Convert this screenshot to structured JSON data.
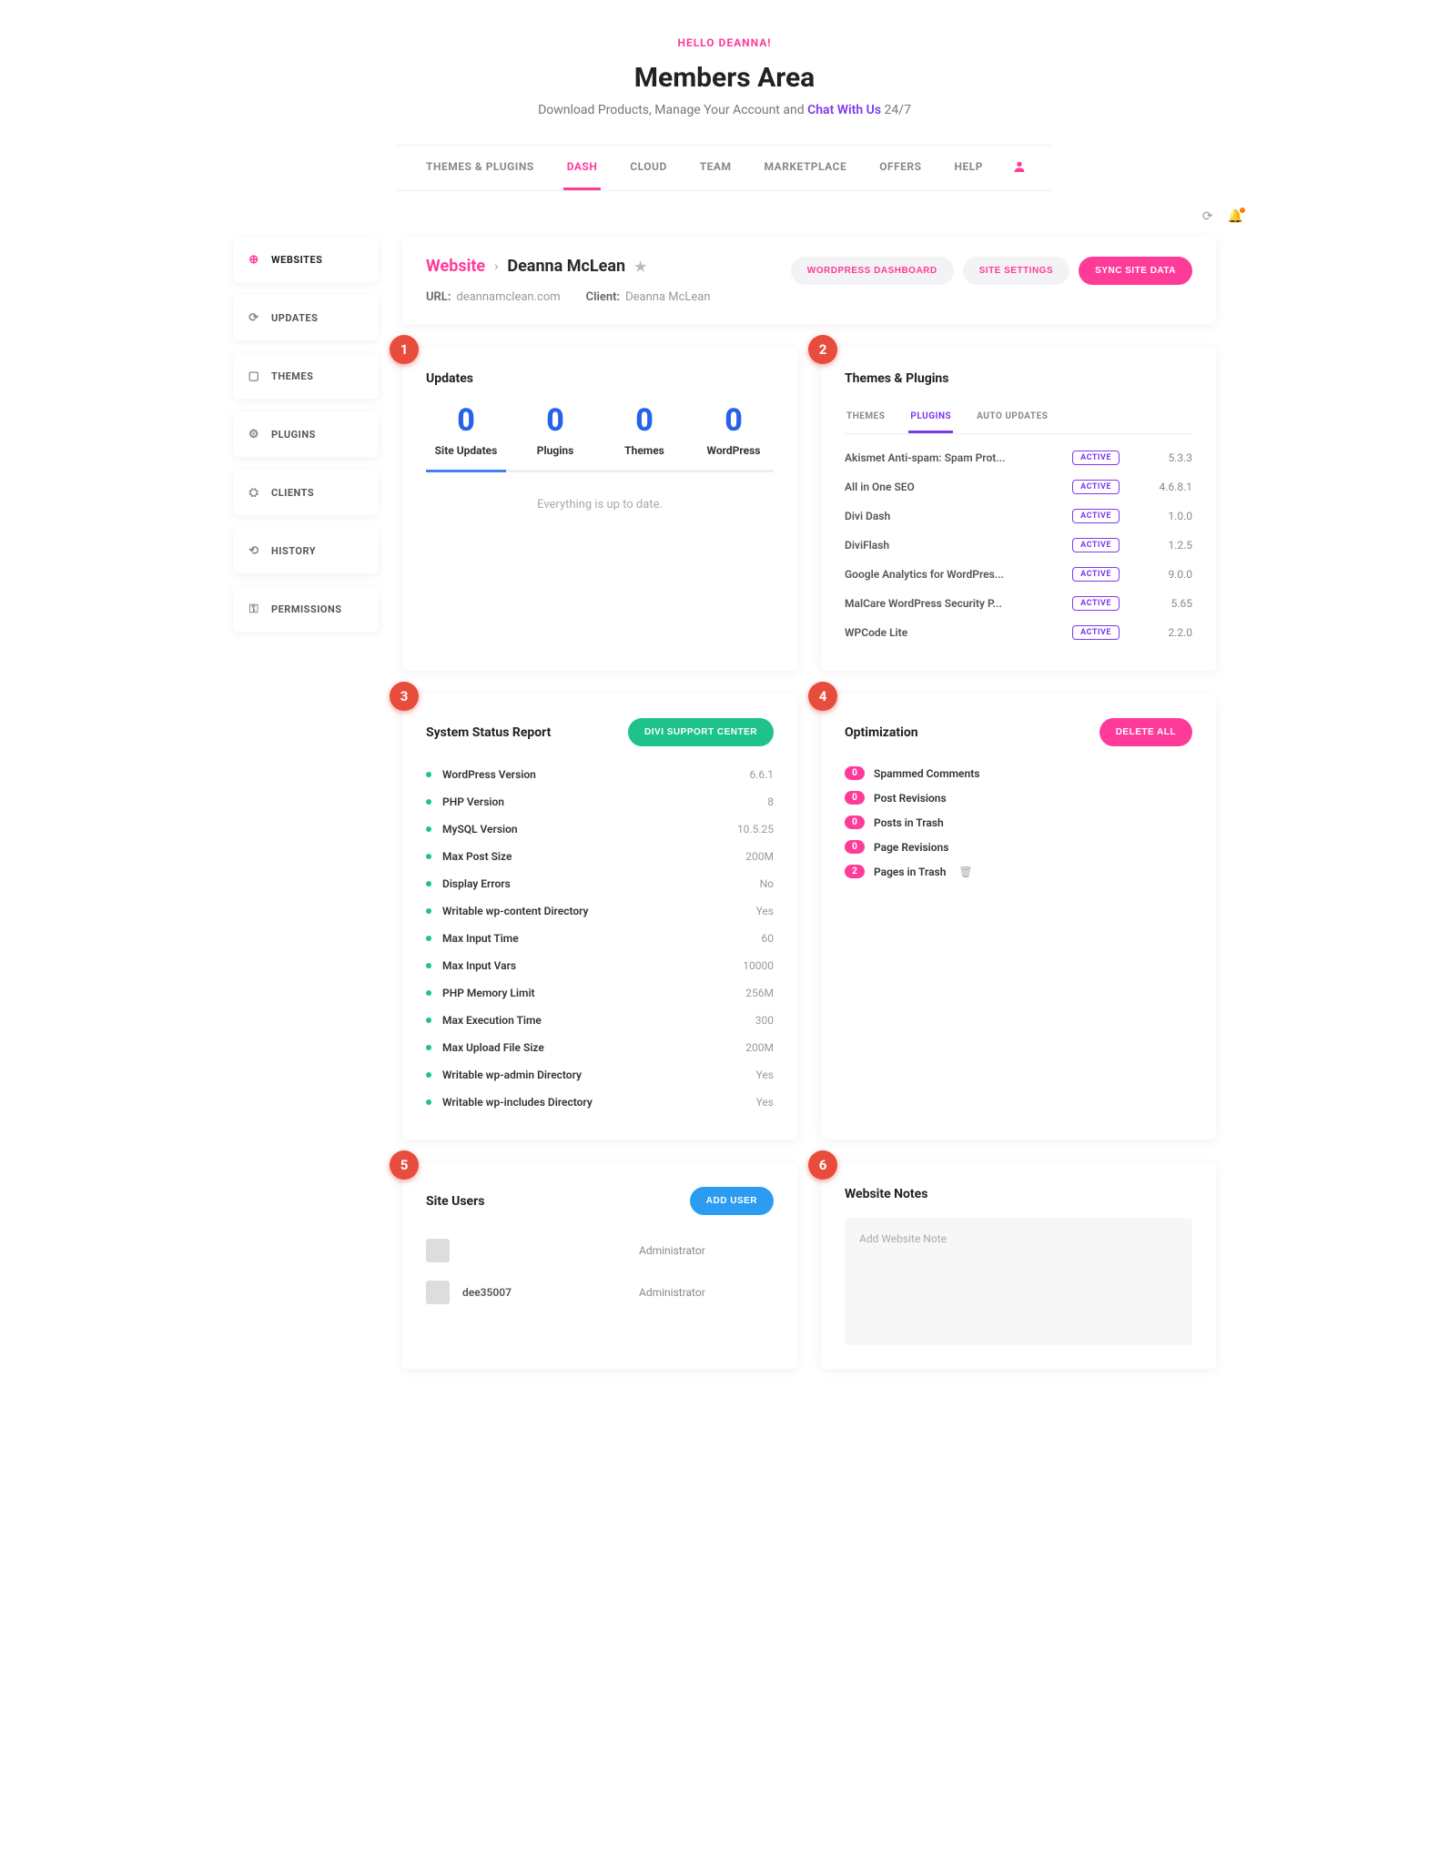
{
  "header": {
    "greeting": "HELLO DEANNA!",
    "title": "Members Area",
    "subtitle_pre": "Download Products, Manage Your Account and ",
    "subtitle_chat": "Chat With Us",
    "subtitle_post": " 24/7"
  },
  "nav": {
    "items": [
      {
        "label": "THEMES & PLUGINS"
      },
      {
        "label": "DASH"
      },
      {
        "label": "CLOUD"
      },
      {
        "label": "TEAM"
      },
      {
        "label": "MARKETPLACE"
      },
      {
        "label": "OFFERS"
      },
      {
        "label": "HELP"
      }
    ]
  },
  "sidebar": {
    "items": [
      {
        "icon": "⊕",
        "label": "WEBSITES"
      },
      {
        "icon": "⟳",
        "label": "UPDATES"
      },
      {
        "icon": "▢",
        "label": "THEMES"
      },
      {
        "icon": "⚙",
        "label": "PLUGINS"
      },
      {
        "icon": "⛭",
        "label": "CLIENTS"
      },
      {
        "icon": "⟲",
        "label": "HISTORY"
      },
      {
        "icon": "⚿",
        "label": "PERMISSIONS"
      }
    ]
  },
  "site": {
    "breadcrumb_root": "Website",
    "name": "Deanna McLean",
    "url_label": "URL:",
    "url": "deannamclean.com",
    "client_label": "Client:",
    "client": "Deanna McLean",
    "actions": {
      "wp": "WORDPRESS DASHBOARD",
      "settings": "SITE SETTINGS",
      "sync": "SYNC SITE DATA"
    }
  },
  "updates": {
    "title": "Updates",
    "cols": [
      {
        "val": "0",
        "label": "Site Updates"
      },
      {
        "val": "0",
        "label": "Plugins"
      },
      {
        "val": "0",
        "label": "Themes"
      },
      {
        "val": "0",
        "label": "WordPress"
      }
    ],
    "uptodate": "Everything is up to date."
  },
  "tp": {
    "title": "Themes & Plugins",
    "tabs": [
      {
        "label": "THEMES"
      },
      {
        "label": "PLUGINS"
      },
      {
        "label": "AUTO UPDATES"
      }
    ],
    "active_label": "ACTIVE",
    "plugins": [
      {
        "name": "Akismet Anti-spam: Spam Prot...",
        "ver": "5.3.3"
      },
      {
        "name": "All in One SEO",
        "ver": "4.6.8.1"
      },
      {
        "name": "Divi Dash",
        "ver": "1.0.0"
      },
      {
        "name": "DiviFlash",
        "ver": "1.2.5"
      },
      {
        "name": "Google Analytics for WordPres...",
        "ver": "9.0.0"
      },
      {
        "name": "MalCare WordPress Security P...",
        "ver": "5.65"
      },
      {
        "name": "WPCode Lite",
        "ver": "2.2.0"
      }
    ]
  },
  "status": {
    "title": "System Status Report",
    "btn": "DIVI SUPPORT CENTER",
    "rows": [
      {
        "name": "WordPress Version",
        "val": "6.6.1"
      },
      {
        "name": "PHP Version",
        "val": "8"
      },
      {
        "name": "MySQL Version",
        "val": "10.5.25"
      },
      {
        "name": "Max Post Size",
        "val": "200M"
      },
      {
        "name": "Display Errors",
        "val": "No"
      },
      {
        "name": "Writable wp-content Directory",
        "val": "Yes"
      },
      {
        "name": "Max Input Time",
        "val": "60"
      },
      {
        "name": "Max Input Vars",
        "val": "10000"
      },
      {
        "name": "PHP Memory Limit",
        "val": "256M"
      },
      {
        "name": "Max Execution Time",
        "val": "300"
      },
      {
        "name": "Max Upload File Size",
        "val": "200M"
      },
      {
        "name": "Writable wp-admin Directory",
        "val": "Yes"
      },
      {
        "name": "Writable wp-includes Directory",
        "val": "Yes"
      }
    ]
  },
  "opt": {
    "title": "Optimization",
    "btn": "DELETE ALL",
    "rows": [
      {
        "count": "0",
        "name": "Spammed Comments"
      },
      {
        "count": "0",
        "name": "Post Revisions"
      },
      {
        "count": "0",
        "name": "Posts in Trash"
      },
      {
        "count": "0",
        "name": "Page Revisions"
      },
      {
        "count": "2",
        "name": "Pages in Trash",
        "trash": true
      }
    ]
  },
  "users": {
    "title": "Site Users",
    "btn": "ADD USER",
    "rows": [
      {
        "name": "",
        "role": "Administrator",
        "blur": true
      },
      {
        "name": "dee35007",
        "role": "Administrator"
      }
    ]
  },
  "notes": {
    "title": "Website Notes",
    "placeholder": "Add Website Note"
  },
  "badges": [
    "1",
    "2",
    "3",
    "4",
    "5",
    "6"
  ]
}
